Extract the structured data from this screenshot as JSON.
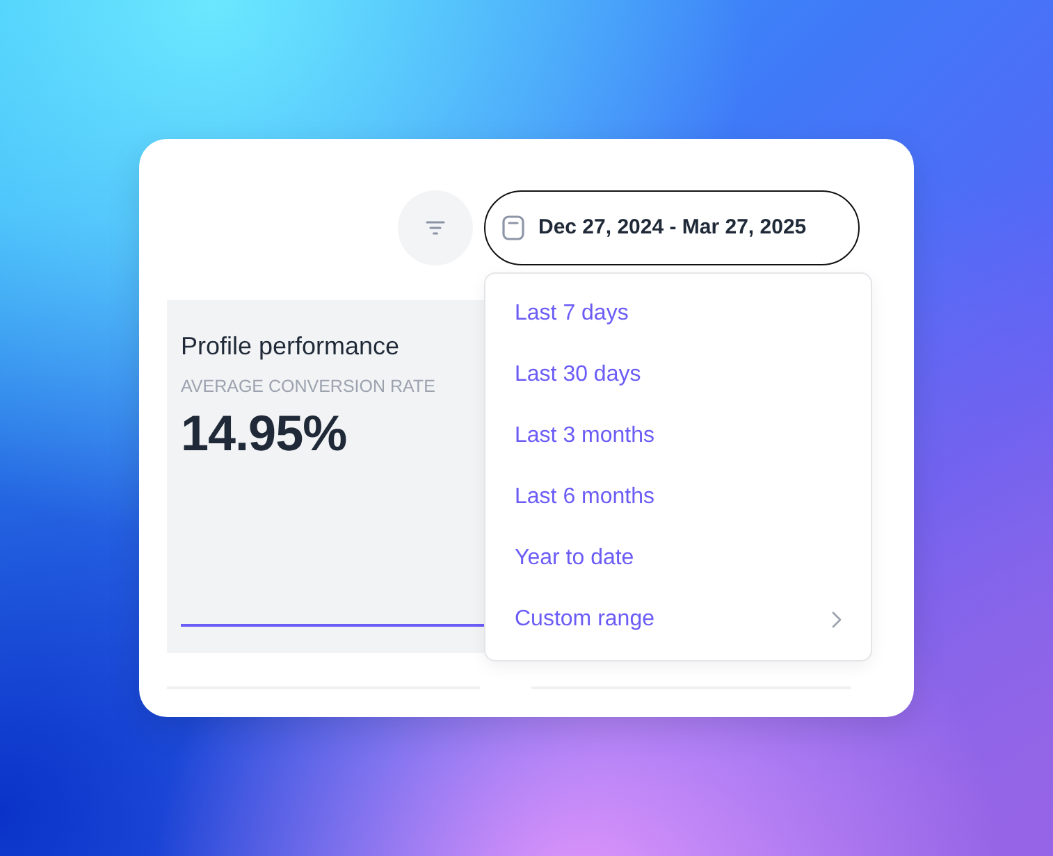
{
  "filter_button": {
    "kind": "icon"
  },
  "date_range_button": {
    "label": "Dec 27, 2024 - Mar 27, 2025",
    "expanded": true
  },
  "panel": {
    "title": "Profile performance",
    "metric_label": "AVERAGE CONVERSION RATE",
    "metric_value": "14.95%"
  },
  "date_menu": {
    "items": [
      {
        "label": "Last 7 days",
        "kind": "option"
      },
      {
        "label": "Last 30 days",
        "kind": "option"
      },
      {
        "label": "Last 3 months",
        "kind": "option"
      },
      {
        "label": "Last 6 months",
        "kind": "option"
      },
      {
        "label": "Year to date",
        "kind": "option"
      },
      {
        "label": "Custom range",
        "kind": "submenu"
      }
    ]
  }
}
